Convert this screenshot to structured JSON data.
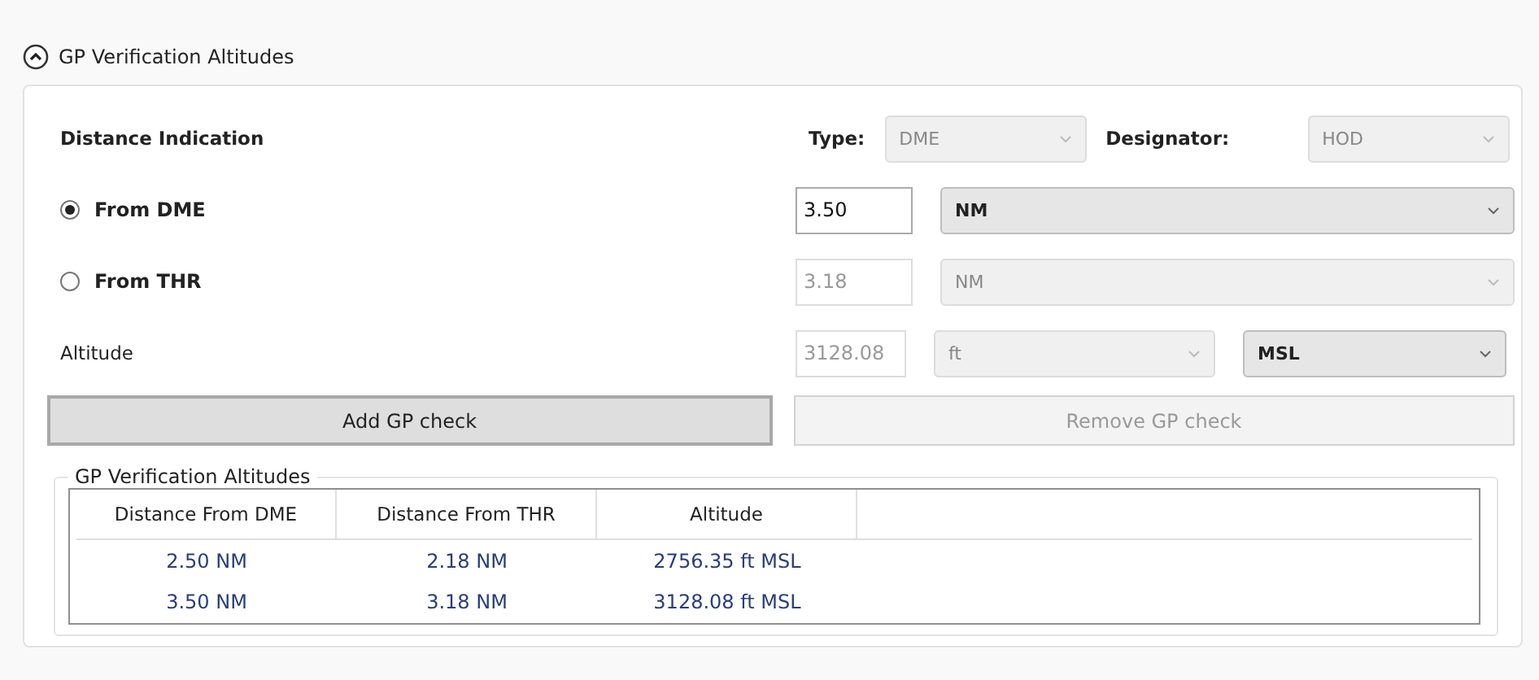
{
  "section": {
    "title": "GP Verification Altitudes",
    "expanded": true
  },
  "distance_indication": {
    "label": "Distance Indication",
    "type_label": "Type:",
    "type_combo": {
      "value": "DME",
      "disabled": true
    },
    "designator_label": "Designator:",
    "designator_combo": {
      "value": "HOD",
      "disabled": true
    }
  },
  "options": [
    {
      "label": "From DME",
      "selected": true,
      "field": {
        "value": "3.50",
        "disabled": false
      },
      "unit": {
        "value": "NM",
        "disabled": false
      }
    },
    {
      "label": "From THR",
      "selected": false,
      "field": {
        "value": "3.18",
        "disabled": true
      },
      "unit": {
        "value": "NM",
        "disabled": true
      }
    }
  ],
  "altitude": {
    "label": "Altitude",
    "field": {
      "value": "3128.08",
      "disabled": true
    },
    "unit": {
      "value": "ft",
      "disabled": true
    },
    "reference": {
      "value": "MSL",
      "disabled": false
    }
  },
  "buttons": [
    {
      "label": "Add GP check",
      "disabled": false
    },
    {
      "label": "Remove GP check",
      "disabled": true
    }
  ],
  "table": {
    "title": "GP Verification Altitudes",
    "columns": [
      "Distance From DME",
      "Distance From THR",
      "Altitude"
    ],
    "rows": [
      [
        "2.50 NM",
        "2.18 NM",
        "2756.35 ft MSL"
      ],
      [
        "3.50 NM",
        "3.18 NM",
        "3128.08 ft MSL"
      ]
    ]
  }
}
